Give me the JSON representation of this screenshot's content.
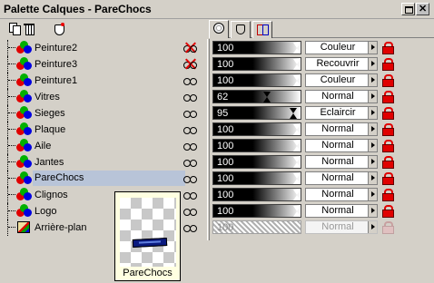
{
  "window": {
    "title": "Palette Calques - PareChocs"
  },
  "layers": [
    {
      "name": "Peinture2",
      "visible": false,
      "opacity": "100",
      "blend": "Couleur",
      "type": "vector"
    },
    {
      "name": "Peinture3",
      "visible": false,
      "opacity": "100",
      "blend": "Recouvrir",
      "type": "vector"
    },
    {
      "name": "Peinture1",
      "visible": true,
      "opacity": "100",
      "blend": "Couleur",
      "type": "vector"
    },
    {
      "name": "Vitres",
      "visible": true,
      "opacity": "62",
      "blend": "Normal",
      "type": "vector"
    },
    {
      "name": "Sieges",
      "visible": true,
      "opacity": "95",
      "blend": "Eclaircir",
      "type": "vector"
    },
    {
      "name": "Plaque",
      "visible": true,
      "opacity": "100",
      "blend": "Normal",
      "type": "vector"
    },
    {
      "name": "Aile",
      "visible": true,
      "opacity": "100",
      "blend": "Normal",
      "type": "vector"
    },
    {
      "name": "Jantes",
      "visible": true,
      "opacity": "100",
      "blend": "Normal",
      "type": "vector"
    },
    {
      "name": "PareChocs",
      "visible": true,
      "opacity": "100",
      "blend": "Normal",
      "type": "vector",
      "selected": true
    },
    {
      "name": "Clignos",
      "visible": true,
      "opacity": "100",
      "blend": "Normal",
      "type": "vector"
    },
    {
      "name": "Logo",
      "visible": true,
      "opacity": "100",
      "blend": "Normal",
      "type": "vector"
    },
    {
      "name": "Arrière-plan",
      "visible": true,
      "opacity": "100",
      "blend": "Normal",
      "type": "raster",
      "disabled": true
    }
  ],
  "tooltip": {
    "label": "PareChocs"
  },
  "colors": {
    "selection": "#b8c4d8",
    "tooltip_bg": "#ffffe1",
    "lock_red": "#e00000"
  }
}
